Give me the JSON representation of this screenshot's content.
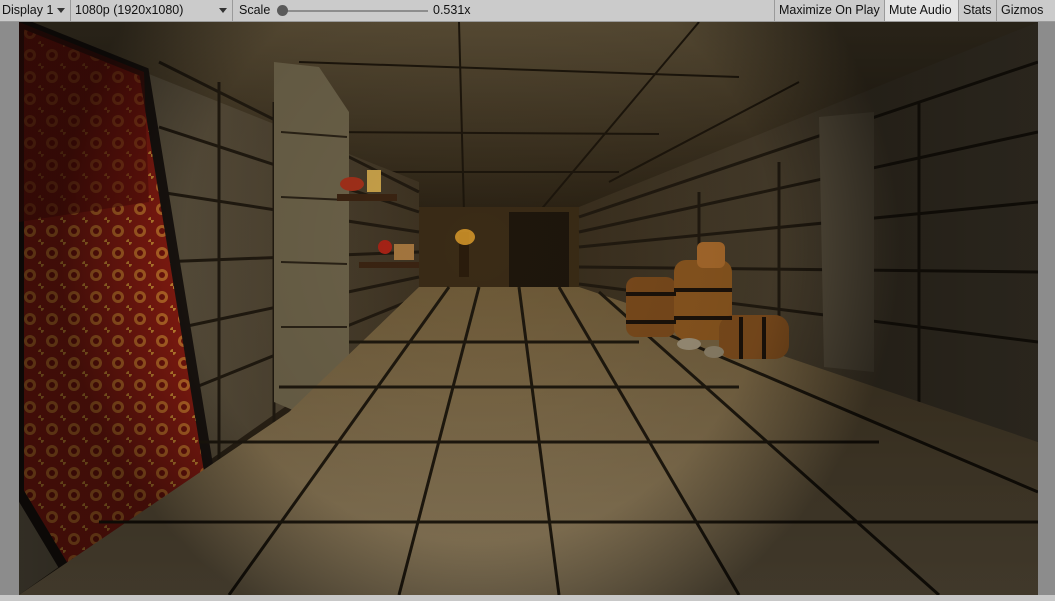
{
  "toolbar": {
    "display_label": "Display 1",
    "resolution_label": "1080p (1920x1080)",
    "scale_label": "Scale",
    "scale_value_text": "0.531x",
    "scale_value": 0.0,
    "maximize_label": "Maximize On Play",
    "mute_label": "Mute Audio",
    "stats_label": "Stats",
    "gizmos_label": "Gizmos"
  },
  "colors": {
    "toolbar_bg": "#cbcbcb",
    "active_toggle_bg": "#e4e4e4",
    "tapestry_red": "#9b1f15",
    "torch_glow": "#d99a2a"
  }
}
